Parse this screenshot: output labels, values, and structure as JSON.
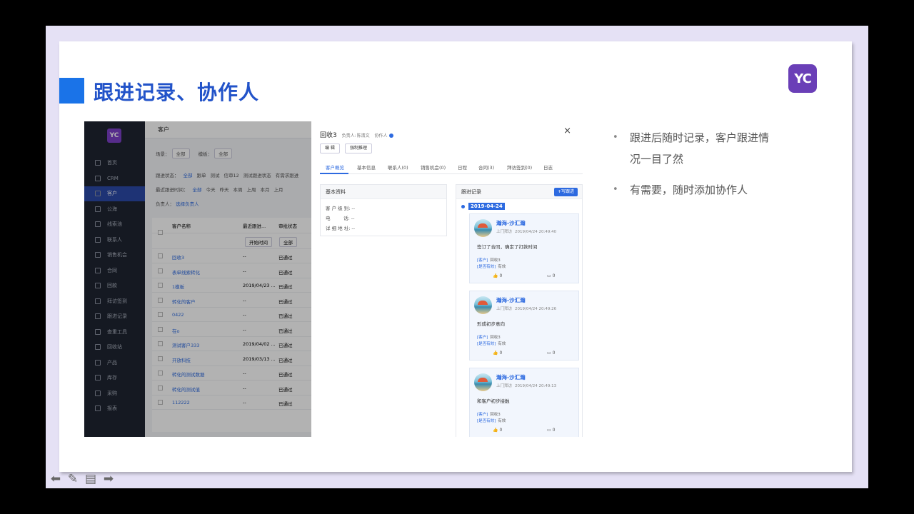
{
  "slide": {
    "title": "跟进记录、协作人",
    "logo_text": "YC"
  },
  "bullets": [
    "跟进后随时记录，客户跟进情况一目了然",
    "有需要，随时添加协作人"
  ],
  "crm": {
    "logo": "YC",
    "header": "客户",
    "sidebar": [
      {
        "icon": "home-icon",
        "label": "首页"
      },
      {
        "icon": "crm-icon",
        "label": "CRM"
      },
      {
        "icon": "customer-icon",
        "label": "客户"
      },
      {
        "icon": "pool-icon",
        "label": "公海"
      },
      {
        "icon": "lead-icon",
        "label": "线索池"
      },
      {
        "icon": "contact-icon",
        "label": "联系人"
      },
      {
        "icon": "opportunity-icon",
        "label": "销售机会"
      },
      {
        "icon": "contract-icon",
        "label": "合同"
      },
      {
        "icon": "payment-icon",
        "label": "回款"
      },
      {
        "icon": "visit-icon",
        "label": "拜访签到"
      },
      {
        "icon": "followup-icon",
        "label": "跟进记录"
      },
      {
        "icon": "tools-icon",
        "label": "查重工具"
      },
      {
        "icon": "recycle-icon",
        "label": "回收站"
      },
      {
        "icon": "product-icon",
        "label": "产品"
      },
      {
        "icon": "inventory-icon",
        "label": "库存"
      },
      {
        "icon": "purchase-icon",
        "label": "采购"
      },
      {
        "icon": "report-icon",
        "label": "报表"
      }
    ],
    "filters": {
      "scene_label": "场景：",
      "scene_value": "全部",
      "template_label": "模板：",
      "template_value": "全部",
      "status_label": "跟进状态：",
      "status_options": [
        "全部",
        "跟单",
        "测试",
        "信审12",
        "测试跟进状态",
        "有需求跟进"
      ],
      "time_label": "最近跟进时间：",
      "time_options": [
        "全部",
        "今天",
        "昨天",
        "本周",
        "上周",
        "本月",
        "上月"
      ],
      "owner_label": "负责人：",
      "owner_value": "选择负责人"
    },
    "table": {
      "headers": [
        "客户名称",
        "最近跟进...",
        "审批状态"
      ],
      "search_placeholder": "开始时间",
      "approval_filter": "全部",
      "rows": [
        {
          "name": "回收3",
          "date": "--",
          "status": "已通过"
        },
        {
          "name": "表单线索转化",
          "date": "--",
          "status": "已通过"
        },
        {
          "name": "1模板",
          "date": "2019/04/23 ...",
          "status": "已通过"
        },
        {
          "name": "转化的客户",
          "date": "--",
          "status": "已通过"
        },
        {
          "name": "0422",
          "date": "--",
          "status": "已通过"
        },
        {
          "name": "在o",
          "date": "--",
          "status": "已通过"
        },
        {
          "name": "测试客户333",
          "date": "2019/04/02 ...",
          "status": "已通过"
        },
        {
          "name": "开放科技",
          "date": "2019/03/13 ...",
          "status": "已通过"
        },
        {
          "name": "转化的测试数据",
          "date": "--",
          "status": "已通过"
        },
        {
          "name": "转化的测试值",
          "date": "--",
          "status": "已通过"
        },
        {
          "name": "112222",
          "date": "--",
          "status": "已通过"
        }
      ]
    }
  },
  "panel": {
    "title": "回收3",
    "owner_label": "负责人:",
    "owner": "陈清文",
    "collab_label": "协作人",
    "close": "×",
    "buttons": [
      "编 辑",
      "强制推理"
    ],
    "tabs": [
      "客户概览",
      "基本信息",
      "联系人(0)",
      "销售机会(0)",
      "日程",
      "合同(3)",
      "拜访签到(0)",
      "日志"
    ],
    "basic": {
      "title": "基本资料",
      "fields": [
        {
          "k": "客 户 级 别:",
          "v": "--"
        },
        {
          "k": "电         话:",
          "v": "--"
        },
        {
          "k": "详 细 地 址:",
          "v": "--"
        }
      ]
    },
    "followup": {
      "title": "跟进记录",
      "add_button": "+写跟进",
      "date": "2019-04-24",
      "entries": [
        {
          "name": "瀚海-沙汇瀚",
          "type": "上门拜访",
          "time": "2019/04/24 20:49:40",
          "content": "签订了合同，确定了打款时间",
          "customer_tag": "[客户]",
          "customer": "回收3",
          "valid_tag": "[是否有效]",
          "valid": "有效",
          "likes": "0",
          "comments": "0"
        },
        {
          "name": "瀚海-沙汇瀚",
          "type": "上门拜访",
          "time": "2019/04/24 20:49:26",
          "content": "形成初步意向",
          "customer_tag": "[客户]",
          "customer": "回收3",
          "valid_tag": "[是否有效]",
          "valid": "有效",
          "likes": "0",
          "comments": "0"
        },
        {
          "name": "瀚海-沙汇瀚",
          "type": "上门拜访",
          "time": "2019/04/24 20:49:13",
          "content": "和客户初步接触",
          "customer_tag": "[客户]",
          "customer": "回收3",
          "valid_tag": "[是否有效]",
          "valid": "有效",
          "likes": "0",
          "comments": "0"
        }
      ]
    }
  },
  "colors": {
    "accent": "#2253c9",
    "brand": "#6a3fb7",
    "link": "#2d6ae0"
  }
}
